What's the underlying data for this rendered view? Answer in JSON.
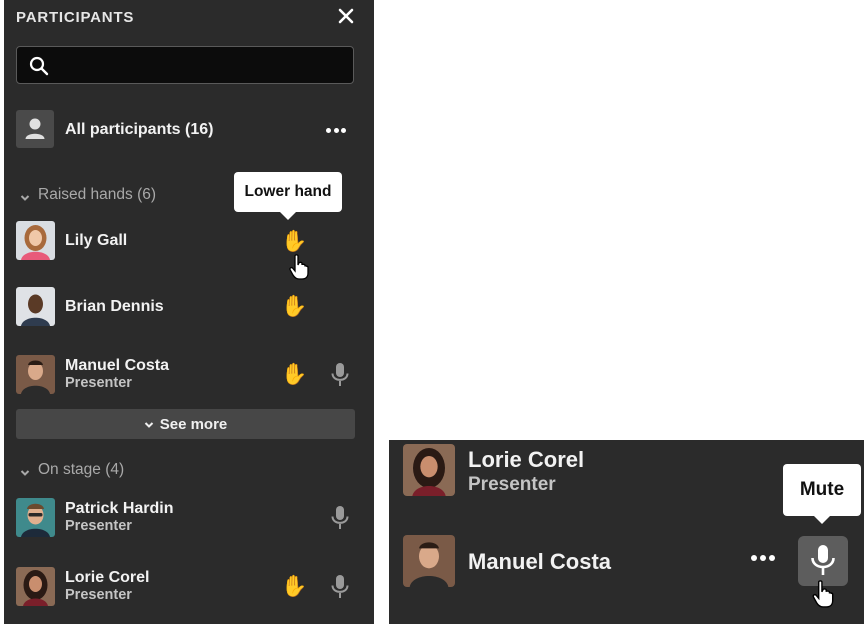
{
  "panel": {
    "title": "PARTICIPANTS",
    "search_placeholder": "",
    "all_participants_label": "All participants (16)"
  },
  "raised_hands": {
    "header": "Raised hands (6)",
    "tooltip": "Lower hand",
    "people": [
      {
        "name": "Lily Gall",
        "role": ""
      },
      {
        "name": "Brian Dennis",
        "role": ""
      },
      {
        "name": "Manuel Costa",
        "role": "Presenter"
      }
    ],
    "see_more_label": "See more"
  },
  "on_stage": {
    "header": "On stage (4)",
    "people": [
      {
        "name": "Patrick Hardin",
        "role": "Presenter"
      },
      {
        "name": "Lorie Corel",
        "role": "Presenter"
      }
    ]
  },
  "zoom": {
    "top_person": {
      "name": "Lorie Corel",
      "role": "Presenter"
    },
    "main_person": {
      "name": "Manuel Costa"
    },
    "tooltip": "Mute"
  },
  "colors": {
    "panel_bg": "#2b2b2b",
    "hand": "#f5b800",
    "see_more_bg": "#474747",
    "muted_text": "#a9a9a9"
  },
  "icons": [
    "close-icon",
    "search-icon",
    "person-icon",
    "more-icon",
    "chevron-down-icon",
    "raised-hand-icon",
    "microphone-icon",
    "hand-pointer-cursor"
  ]
}
